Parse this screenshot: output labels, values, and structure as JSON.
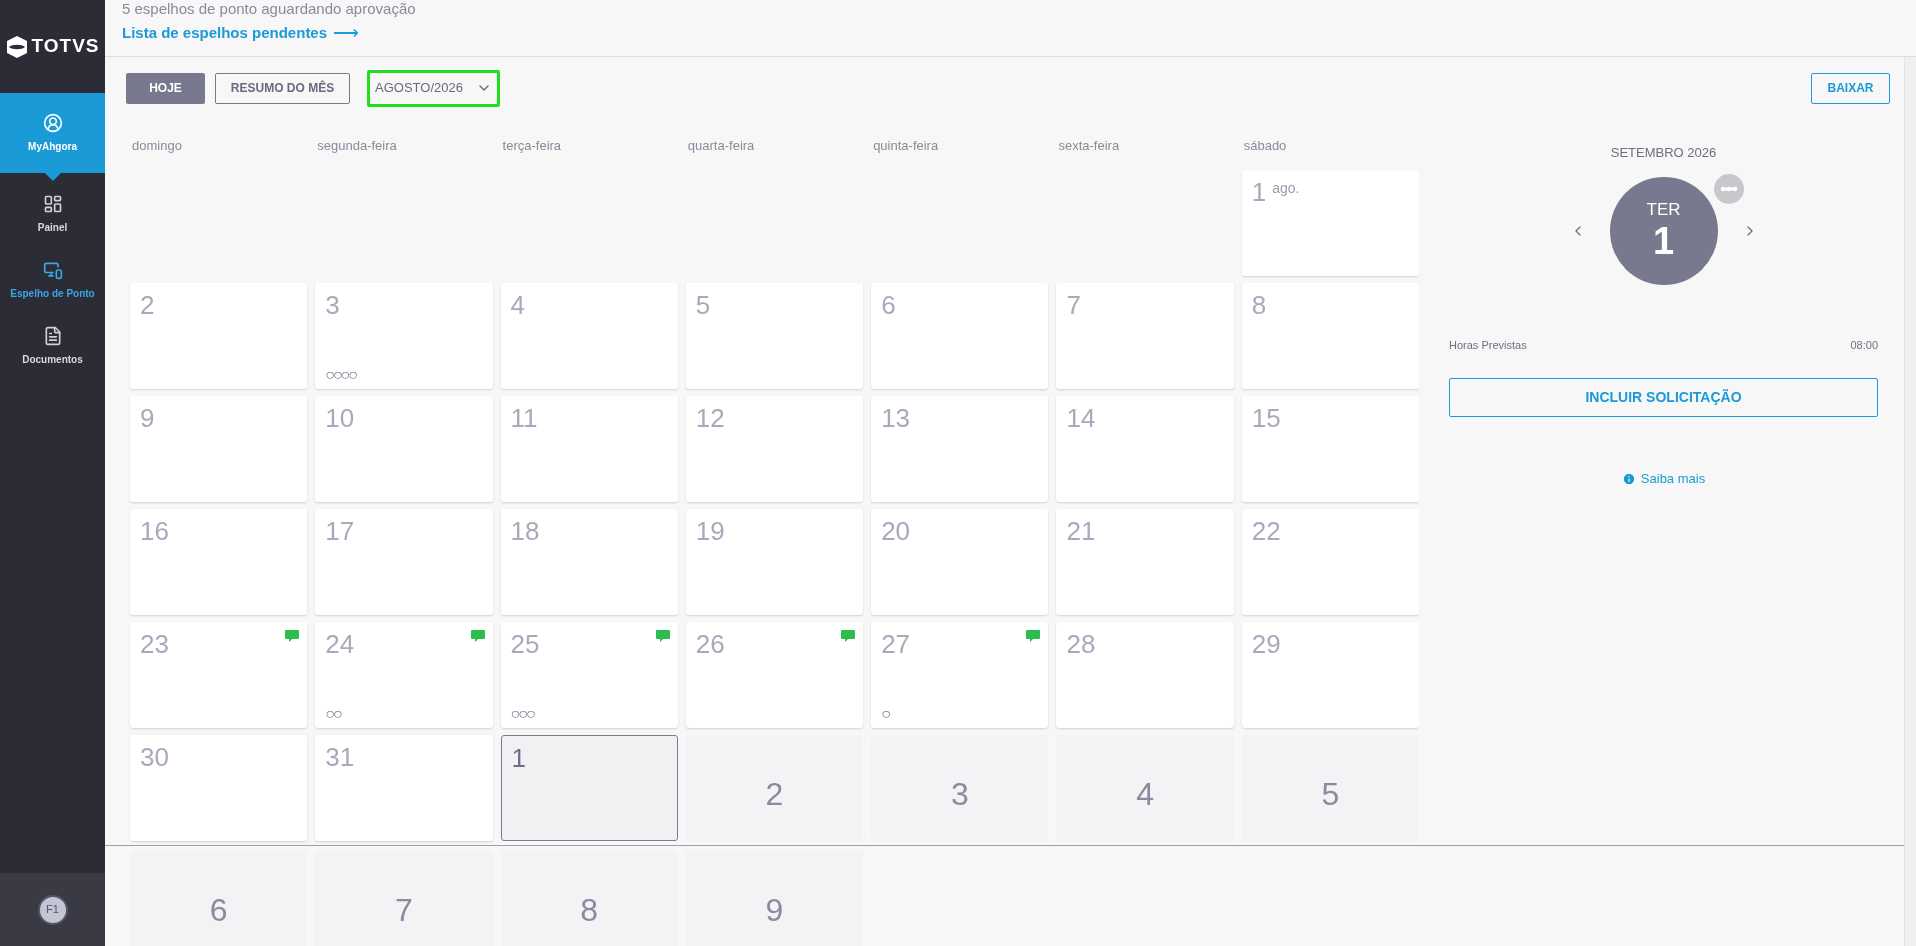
{
  "header": {
    "notice": "5 espelhos de ponto aguardando aprovação",
    "link": "Lista de espelhos pendentes",
    "link_arrow": "⟶"
  },
  "sidebar": {
    "logo": "TOTVS",
    "items": [
      {
        "label": "MyAhgora",
        "kind": "user",
        "selected": true
      },
      {
        "label": "Painel",
        "kind": "panel",
        "selected": false
      },
      {
        "label": "Espelho de Ponto",
        "kind": "monitor",
        "selected": false
      },
      {
        "label": "Documentos",
        "kind": "document",
        "selected": false
      }
    ],
    "user": "F1"
  },
  "toolbar": {
    "today": "HOJE",
    "summary": "RESUMO DO MÊS",
    "month": "AGOSTO/2026",
    "download": "BAIXAR"
  },
  "calendar": {
    "weekdays": [
      "domingo",
      "segunda-feira",
      "terça-feira",
      "quarta-feira",
      "quinta-feira",
      "sexta-feira",
      "sábado"
    ],
    "weeks": [
      [
        {
          "kind": "blank"
        },
        {
          "kind": "blank"
        },
        {
          "kind": "blank"
        },
        {
          "kind": "blank"
        },
        {
          "kind": "blank"
        },
        {
          "kind": "blank"
        },
        {
          "kind": "current",
          "day": "1",
          "month_label": "ago.",
          "comment": false,
          "selected": false
        }
      ],
      [
        {
          "kind": "current",
          "day": "2",
          "comment": false,
          "selected": false
        },
        {
          "kind": "current",
          "day": "3",
          "marks": "○○○○",
          "comment": false,
          "selected": false
        },
        {
          "kind": "current",
          "day": "4",
          "comment": false,
          "selected": false
        },
        {
          "kind": "current",
          "day": "5",
          "comment": false,
          "selected": false
        },
        {
          "kind": "current",
          "day": "6",
          "comment": false,
          "selected": false
        },
        {
          "kind": "current",
          "day": "7",
          "comment": false,
          "selected": false
        },
        {
          "kind": "current",
          "day": "8",
          "comment": false,
          "selected": false
        }
      ],
      [
        {
          "kind": "current",
          "day": "9",
          "comment": false,
          "selected": false
        },
        {
          "kind": "current",
          "day": "10",
          "comment": false,
          "selected": false
        },
        {
          "kind": "current",
          "day": "11",
          "comment": false,
          "selected": false
        },
        {
          "kind": "current",
          "day": "12",
          "comment": false,
          "selected": false
        },
        {
          "kind": "current",
          "day": "13",
          "comment": false,
          "selected": false
        },
        {
          "kind": "current",
          "day": "14",
          "comment": false,
          "selected": false
        },
        {
          "kind": "current",
          "day": "15",
          "comment": false,
          "selected": false
        }
      ],
      [
        {
          "kind": "current",
          "day": "16",
          "comment": false,
          "selected": false
        },
        {
          "kind": "current",
          "day": "17",
          "comment": false,
          "selected": false
        },
        {
          "kind": "current",
          "day": "18",
          "comment": false,
          "selected": false
        },
        {
          "kind": "current",
          "day": "19",
          "comment": false,
          "selected": false
        },
        {
          "kind": "current",
          "day": "20",
          "comment": false,
          "selected": false
        },
        {
          "kind": "current",
          "day": "21",
          "comment": false,
          "selected": false
        },
        {
          "kind": "current",
          "day": "22",
          "comment": false,
          "selected": false
        }
      ],
      [
        {
          "kind": "current",
          "day": "23",
          "comment": true,
          "selected": false
        },
        {
          "kind": "current",
          "day": "24",
          "marks": "○○",
          "comment": true,
          "selected": false
        },
        {
          "kind": "current",
          "day": "25",
          "marks": "○○○",
          "comment": true,
          "selected": false
        },
        {
          "kind": "current",
          "day": "26",
          "comment": true,
          "selected": false
        },
        {
          "kind": "current",
          "day": "27",
          "marks": "○",
          "comment": true,
          "selected": false
        },
        {
          "kind": "current",
          "day": "28",
          "comment": false,
          "selected": false
        },
        {
          "kind": "current",
          "day": "29",
          "comment": false,
          "selected": false
        }
      ],
      [
        {
          "kind": "current",
          "day": "30",
          "comment": false,
          "selected": false
        },
        {
          "kind": "current",
          "day": "31",
          "comment": false,
          "selected": false
        },
        {
          "kind": "current",
          "day": "1",
          "comment": false,
          "selected": true
        },
        {
          "kind": "next",
          "day": "2",
          "selected": false
        },
        {
          "kind": "next",
          "day": "3",
          "selected": false
        },
        {
          "kind": "next",
          "day": "4",
          "selected": false
        },
        {
          "kind": "next",
          "day": "5",
          "selected": false
        }
      ],
      [
        {
          "kind": "next",
          "day": "6",
          "selected": false
        },
        {
          "kind": "next",
          "day": "7",
          "selected": false
        },
        {
          "kind": "next",
          "day": "8",
          "selected": false
        },
        {
          "kind": "next",
          "day": "9",
          "selected": false
        },
        {
          "kind": "blank"
        },
        {
          "kind": "blank"
        },
        {
          "kind": "blank"
        }
      ]
    ]
  },
  "day_panel": {
    "month": "SETEMBRO 2026",
    "weekday": "TER",
    "day": "1",
    "hours_label": "Horas Previstas",
    "hours_value": "08:00",
    "request_button": "INCLUIR SOLICITAÇÃO",
    "help_link": "Saiba mais"
  }
}
